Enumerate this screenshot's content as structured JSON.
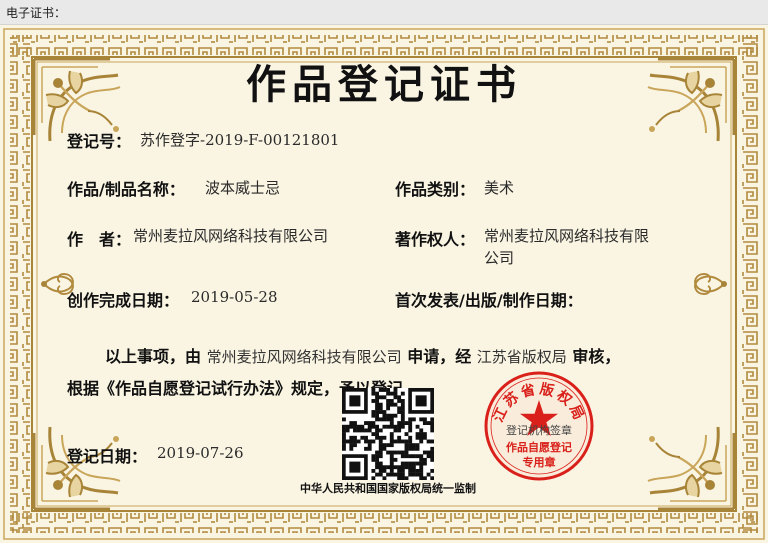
{
  "window": {
    "label": "电子证书："
  },
  "certificate": {
    "title": "作品登记证书",
    "registration_no_label": "登记号：",
    "registration_no": "苏作登字-2019-F-00121801",
    "work_name_label": "作品/制品名称：",
    "work_name": "波本威士忌",
    "category_label": "作品类别：",
    "category": "美术",
    "author_label": "作　者：",
    "author": "常州麦拉风网络科技有限公司",
    "copyright_owner_label": "著作权人：",
    "copyright_owner": "常州麦拉风网络科技有限公司",
    "completion_date_label": "创作完成日期：",
    "completion_date": "2019-05-28",
    "first_publication_label": "首次发表/出版/制作日期：",
    "statement": {
      "part1": "以上事项，由",
      "applicant": "常州麦拉风网络科技有限公司",
      "part2": "申请，经",
      "authority": "江苏省版权局",
      "part3": "审核，",
      "line2": "根据《作品自愿登记试行办法》规定，予以登记。"
    },
    "registration_date_label": "登记日期：",
    "registration_date": "2019-07-26",
    "footer": "中华人民共和国国家版权局统一监制",
    "seal": {
      "top_text": "江苏省版权局",
      "middle_text": "登记机构签章",
      "bottom_line1": "作品自愿登记",
      "bottom_line2": "专用章"
    }
  },
  "colors": {
    "frame_gold": "#c9a55a",
    "frame_dark": "#a88438",
    "paper": "#faf5e3",
    "seal_red": "#d9201a"
  }
}
